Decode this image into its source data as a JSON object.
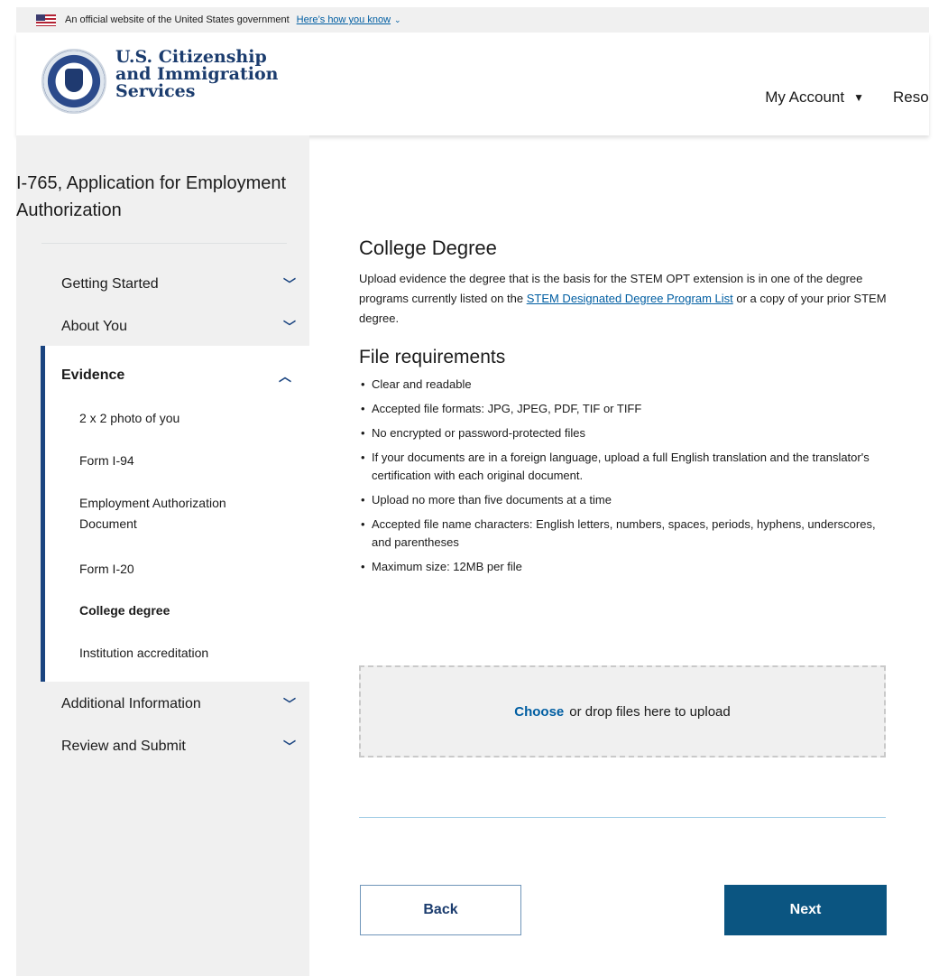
{
  "banner": {
    "text": "An official website of the United States government",
    "link": "Here’s how you know"
  },
  "header": {
    "brand_line1": "U.S. Citizenship",
    "brand_line2": "and Immigration",
    "brand_line3": "Services",
    "nav": [
      {
        "label": "My Account"
      },
      {
        "label": "Resources"
      }
    ]
  },
  "sidebar": {
    "app_title": "I-765, Application for Employment Authorization",
    "sections": [
      {
        "label": "Getting Started"
      },
      {
        "label": "About You"
      },
      {
        "label": "Evidence"
      },
      {
        "label": "Additional Information"
      },
      {
        "label": "Review and Submit"
      }
    ],
    "evidence_items": [
      {
        "label": "2 x 2 photo of you"
      },
      {
        "label": "Form I-94"
      },
      {
        "label": "Employment Authorization Document"
      },
      {
        "label": "Form I-20"
      },
      {
        "label": "College degree"
      },
      {
        "label": "Institution accreditation"
      }
    ]
  },
  "main": {
    "title": "College Degree",
    "intro_before": "Upload evidence the degree that is the basis for the STEM OPT extension is in one of the degree programs currently listed on the ",
    "intro_link": "STEM Designated Degree Program List",
    "intro_after": " or a copy of your prior STEM degree.",
    "file_req_title": "File requirements",
    "requirements": [
      "Clear and readable",
      "Accepted file formats: JPG, JPEG, PDF, TIF or TIFF",
      "No encrypted or password-protected files",
      "If your documents are in a foreign language, upload a full English translation and the translator's certification with each original document.",
      "Upload no more than five documents at a time",
      "Accepted file name characters: English letters, numbers, spaces, periods, hyphens, underscores, and parentheses",
      "Maximum size: 12MB per file"
    ],
    "upload_choose": "Choose",
    "upload_text": "or drop files here to upload",
    "back_label": "Back",
    "next_label": "Next"
  }
}
